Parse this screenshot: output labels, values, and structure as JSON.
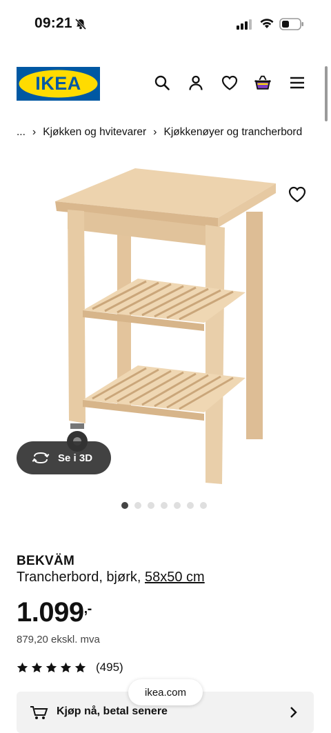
{
  "status_bar": {
    "time": "09:21"
  },
  "header": {
    "logo_text": "IKEA",
    "brand_blue": "#0058a3",
    "brand_yellow": "#ffdb00"
  },
  "breadcrumb": {
    "items": [
      "...",
      "Kjøkken og hvitevarer",
      "Kjøkkenøyer og trancherbord"
    ]
  },
  "gallery": {
    "see_3d_label": "Se i 3D",
    "image_count": 7,
    "active_index": 0
  },
  "product": {
    "name": "BEKVÄM",
    "description": "Trancherbord, bjørk,",
    "size": "58x50 cm",
    "price_main": "1.099",
    "price_suffix": ",-",
    "price_ex_vat": "879,20 ekskl. mva",
    "rating": 5,
    "review_count": "(495)"
  },
  "buy_now": {
    "label": "Kjøp nå, betal senere"
  },
  "url_bar": {
    "domain": "ikea.com"
  }
}
